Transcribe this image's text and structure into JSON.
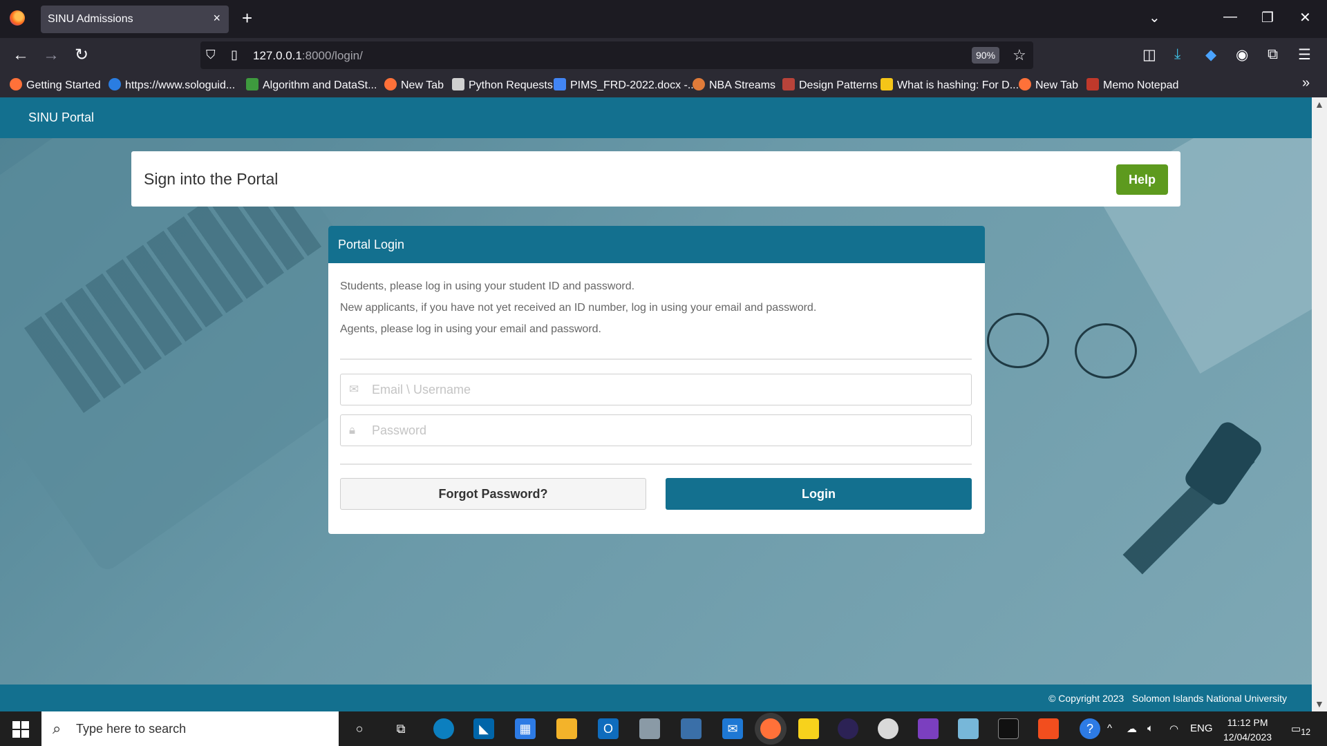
{
  "browser": {
    "tab_title": "SINU Admissions",
    "tab_close": "×",
    "new_tab": "+",
    "url_host": "127.0.0.1",
    "url_rest": ":8000/login/",
    "zoom": "90%",
    "bookmarks": [
      "Getting Started",
      "https://www.sologuid...",
      "Algorithm and DataSt...",
      "New Tab",
      "Python Requests",
      "PIMS_FRD-2022.docx -...",
      "NBA Streams",
      "Design Patterns",
      "What is hashing: For D...",
      "New Tab",
      "Memo Notepad"
    ],
    "bookmark_overflow": "»"
  },
  "page": {
    "header_title": "SINU Portal",
    "signin_title": "Sign into the Portal",
    "help_label": "Help",
    "login_card_title": "Portal Login",
    "instructions": [
      "Students, please log in using your student ID and password.",
      "New applicants, if you have not yet received an ID number, log in using your email and password.",
      "Agents, please log in using your email and password."
    ],
    "email_placeholder": "Email \\ Username",
    "password_placeholder": "Password",
    "forgot_label": "Forgot Password?",
    "login_label": "Login",
    "footer_copyright": "© Copyright 2023",
    "footer_org": "Solomon Islands National University"
  },
  "taskbar": {
    "search_placeholder": "Type here to search",
    "language": "ENG",
    "time": "11:12 PM",
    "date": "12/04/2023",
    "notifications": "12"
  },
  "colors": {
    "brand": "#13708f",
    "help_green": "#5d9a1e"
  }
}
